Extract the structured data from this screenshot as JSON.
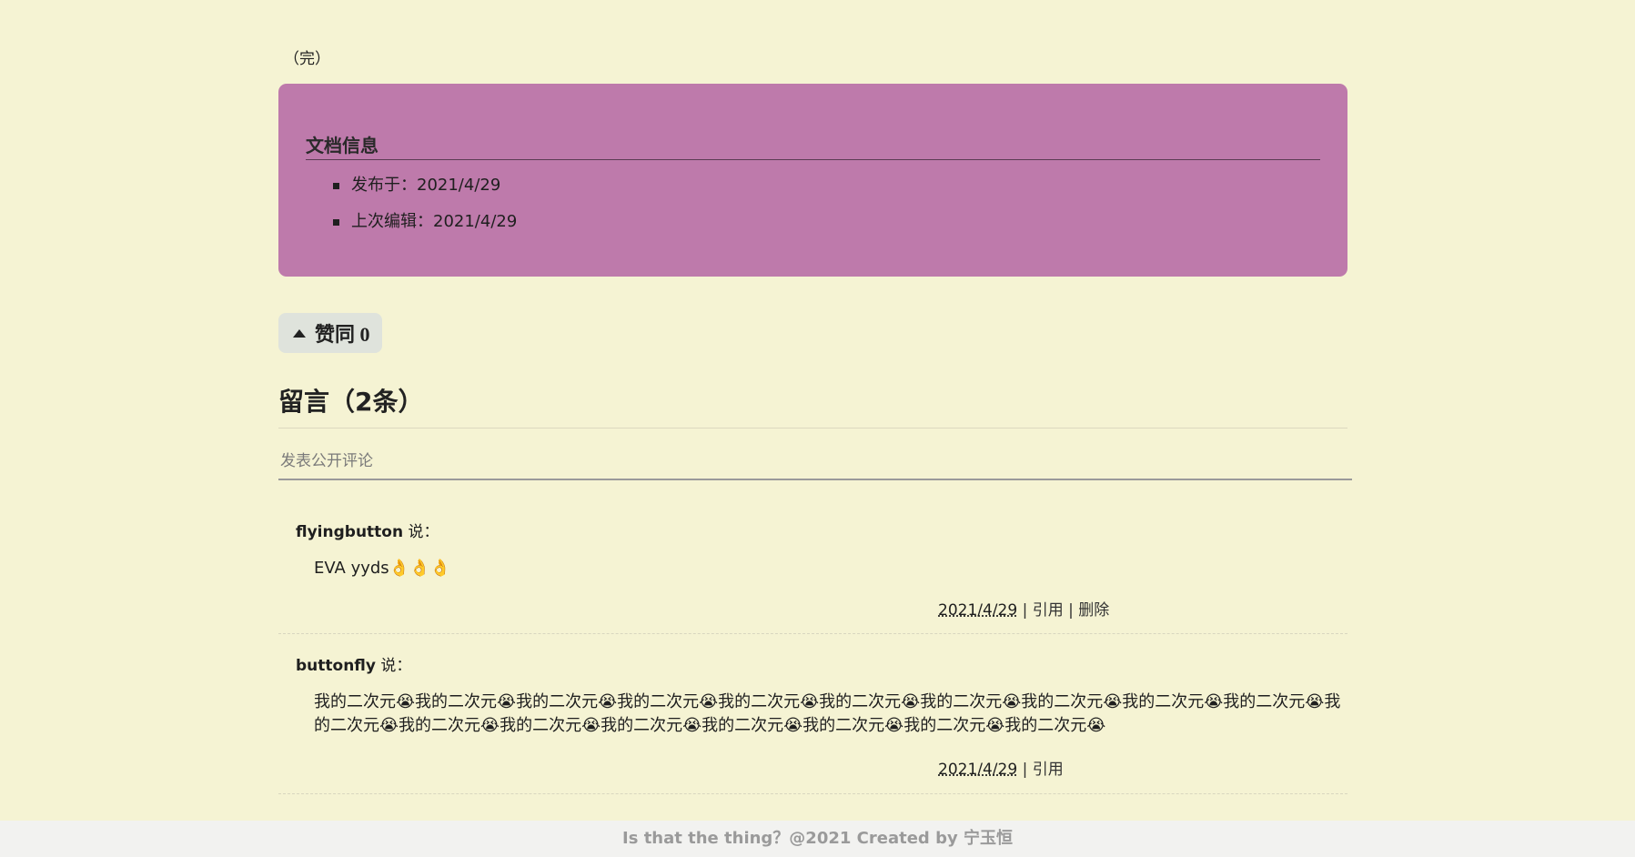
{
  "article": {
    "end_mark": "（完）"
  },
  "doc_info": {
    "title": "文档信息",
    "published": "发布于：2021/4/29",
    "edited": "上次编辑：2021/4/29"
  },
  "like": {
    "label": "赞同 0"
  },
  "comments": {
    "title": "留言（2条）",
    "input_placeholder": "发表公开评论",
    "items": [
      {
        "author": "flyingbutton",
        "says": " 说：",
        "body": "EVA yyds👌👌👌",
        "date": "2021/4/29",
        "quote": "引用",
        "delete": "删除"
      },
      {
        "author": "buttonfly",
        "says": " 说：",
        "body": "我的二次元😭我的二次元😭我的二次元😭我的二次元😭我的二次元😭我的二次元😭我的二次元😭我的二次元😭我的二次元😭我的二次元😭我的二次元😭我的二次元😭我的二次元😭我的二次元😭我的二次元😭我的二次元😭我的二次元😭我的二次元😭",
        "date": "2021/4/29",
        "quote": "引用"
      }
    ]
  },
  "footer": {
    "text": "Is that the thing？@2021 Created by 宁玉恒"
  },
  "colors": {
    "background": "#f5f3d3",
    "info_box": "#be7aab",
    "like_button": "#dfe3dc"
  }
}
